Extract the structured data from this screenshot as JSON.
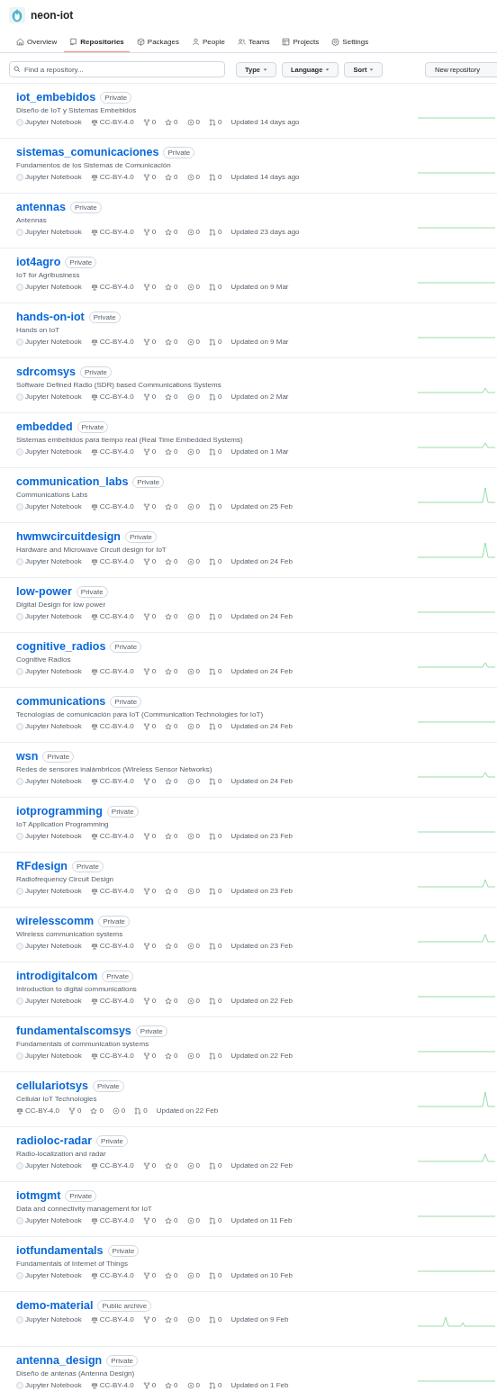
{
  "org": {
    "name": "neon-iot"
  },
  "tabs": [
    {
      "label": "Overview",
      "selected": false
    },
    {
      "label": "Repositories",
      "selected": true
    },
    {
      "label": "Packages",
      "selected": false
    },
    {
      "label": "People",
      "selected": false
    },
    {
      "label": "Teams",
      "selected": false
    },
    {
      "label": "Projects",
      "selected": false
    },
    {
      "label": "Settings",
      "selected": false
    }
  ],
  "search": {
    "placeholder": "Find a repository..."
  },
  "filters": [
    "Type",
    "Language",
    "Sort"
  ],
  "new_button": "New repository",
  "repositories": [
    {
      "name": "iot_embebidos",
      "badge": "Private",
      "description": "Diseño de IoT y Sistemas Embebidos",
      "language": "Jupyter Notebook",
      "license": "CC-BY-4.0",
      "forks": "0",
      "stars": "0",
      "issues": "0",
      "pulls": "0",
      "updated": "Updated 14 days ago"
    },
    {
      "name": "sistemas_comunicaciones",
      "badge": "Private",
      "description": "Fundamentos de los Sistemas de Comunicación",
      "language": "Jupyter Notebook",
      "license": "CC-BY-4.0",
      "forks": "0",
      "stars": "0",
      "issues": "0",
      "pulls": "0",
      "updated": "Updated 14 days ago"
    },
    {
      "name": "antennas",
      "badge": "Private",
      "description": "Antennas",
      "language": "Jupyter Notebook",
      "license": "CC-BY-4.0",
      "forks": "0",
      "stars": "0",
      "issues": "0",
      "pulls": "0",
      "updated": "Updated 23 days ago"
    },
    {
      "name": "iot4agro",
      "badge": "Private",
      "description": "IoT for Agribusiness",
      "language": "Jupyter Notebook",
      "license": "CC-BY-4.0",
      "forks": "0",
      "stars": "0",
      "issues": "0",
      "pulls": "0",
      "updated": "Updated on 9 Mar"
    },
    {
      "name": "hands-on-iot",
      "badge": "Private",
      "description": "Hands on IoT",
      "language": "Jupyter Notebook",
      "license": "CC-BY-4.0",
      "forks": "0",
      "stars": "0",
      "issues": "0",
      "pulls": "0",
      "updated": "Updated on 9 Mar"
    },
    {
      "name": "sdrcomsys",
      "badge": "Private",
      "description": "Software Defined Radio (SDR) based Communications Systems",
      "language": "Jupyter Notebook",
      "license": "CC-BY-4.0",
      "forks": "0",
      "stars": "0",
      "issues": "0",
      "pulls": "0",
      "updated": "Updated on 2 Mar"
    },
    {
      "name": "embedded",
      "badge": "Private",
      "description": "Sistemas embebidos para tiempo real (Real Time Embedded Systems)",
      "language": "Jupyter Notebook",
      "license": "CC-BY-4.0",
      "forks": "0",
      "stars": "0",
      "issues": "0",
      "pulls": "0",
      "updated": "Updated on 1 Mar"
    },
    {
      "name": "communication_labs",
      "badge": "Private",
      "description": "Communications Labs",
      "language": "Jupyter Notebook",
      "license": "CC-BY-4.0",
      "forks": "0",
      "stars": "0",
      "issues": "0",
      "pulls": "0",
      "updated": "Updated on 25 Feb"
    },
    {
      "name": "hwmwcircuitdesign",
      "badge": "Private",
      "description": "Hardware and Microwave Circuit design for IoT",
      "language": "Jupyter Notebook",
      "license": "CC-BY-4.0",
      "forks": "0",
      "stars": "0",
      "issues": "0",
      "pulls": "0",
      "updated": "Updated on 24 Feb"
    },
    {
      "name": "low-power",
      "badge": "Private",
      "description": "Digital Design for low power",
      "language": "Jupyter Notebook",
      "license": "CC-BY-4.0",
      "forks": "0",
      "stars": "0",
      "issues": "0",
      "pulls": "0",
      "updated": "Updated on 24 Feb"
    },
    {
      "name": "cognitive_radios",
      "badge": "Private",
      "description": "Cognitive Radios",
      "language": "Jupyter Notebook",
      "license": "CC-BY-4.0",
      "forks": "0",
      "stars": "0",
      "issues": "0",
      "pulls": "0",
      "updated": "Updated on 24 Feb"
    },
    {
      "name": "communications",
      "badge": "Private",
      "description": "Tecnologías de comunicación para IoT (Communication Technologies for IoT)",
      "language": "Jupyter Notebook",
      "license": "CC-BY-4.0",
      "forks": "0",
      "stars": "0",
      "issues": "0",
      "pulls": "0",
      "updated": "Updated on 24 Feb"
    },
    {
      "name": "wsn",
      "badge": "Private",
      "description": "Redes de sensores inalámbricos (Wireless Sensor Networks)",
      "language": "Jupyter Notebook",
      "license": "CC-BY-4.0",
      "forks": "0",
      "stars": "0",
      "issues": "0",
      "pulls": "0",
      "updated": "Updated on 24 Feb"
    },
    {
      "name": "iotprogramming",
      "badge": "Private",
      "description": "IoT Application Programming",
      "language": "Jupyter Notebook",
      "license": "CC-BY-4.0",
      "forks": "0",
      "stars": "0",
      "issues": "0",
      "pulls": "0",
      "updated": "Updated on 23 Feb"
    },
    {
      "name": "RFdesign",
      "badge": "Private",
      "description": "Radiofrequency Circuit Design",
      "language": "Jupyter Notebook",
      "license": "CC-BY-4.0",
      "forks": "0",
      "stars": "0",
      "issues": "0",
      "pulls": "0",
      "updated": "Updated on 23 Feb"
    },
    {
      "name": "wirelesscomm",
      "badge": "Private",
      "description": "Wireless communication systems",
      "language": "Jupyter Notebook",
      "license": "CC-BY-4.0",
      "forks": "0",
      "stars": "0",
      "issues": "0",
      "pulls": "0",
      "updated": "Updated on 23 Feb"
    },
    {
      "name": "introdigitalcom",
      "badge": "Private",
      "description": "Introduction to digital communications",
      "language": "Jupyter Notebook",
      "license": "CC-BY-4.0",
      "forks": "0",
      "stars": "0",
      "issues": "0",
      "pulls": "0",
      "updated": "Updated on 22 Feb"
    },
    {
      "name": "fundamentalscomsys",
      "badge": "Private",
      "description": "Fundamentals of communication systems",
      "language": "Jupyter Notebook",
      "license": "CC-BY-4.0",
      "forks": "0",
      "stars": "0",
      "issues": "0",
      "pulls": "0",
      "updated": "Updated on 22 Feb"
    },
    {
      "name": "cellulariotsys",
      "badge": "Private",
      "description": "Cellular IoT Technologies",
      "license": "CC-BY-4.0",
      "forks": "0",
      "stars": "0",
      "issues": "0",
      "pulls": "0",
      "updated": "Updated on 22 Feb"
    },
    {
      "name": "radioloc-radar",
      "badge": "Private",
      "description": "Radio-localization and radar",
      "language": "Jupyter Notebook",
      "license": "CC-BY-4.0",
      "forks": "0",
      "stars": "0",
      "issues": "0",
      "pulls": "0",
      "updated": "Updated on 22 Feb"
    },
    {
      "name": "iotmgmt",
      "badge": "Private",
      "description": "Data and connectivity management for IoT",
      "language": "Jupyter Notebook",
      "license": "CC-BY-4.0",
      "forks": "0",
      "stars": "0",
      "issues": "0",
      "pulls": "0",
      "updated": "Updated on 11 Feb"
    },
    {
      "name": "iotfundamentals",
      "badge": "Private",
      "description": "Fundamentals of Internet of Things",
      "language": "Jupyter Notebook",
      "license": "CC-BY-4.0",
      "forks": "0",
      "stars": "0",
      "issues": "0",
      "pulls": "0",
      "updated": "Updated on 10 Feb"
    },
    {
      "name": "demo-material",
      "badge": "Public archive",
      "language": "Jupyter Notebook",
      "license": "CC-BY-4.0",
      "forks": "0",
      "stars": "0",
      "issues": "0",
      "pulls": "0",
      "updated": "Updated on 9 Feb"
    },
    {
      "name": "antenna_design",
      "badge": "Private",
      "description": "Diseño de antenas (Antenna Design)",
      "language": "Jupyter Notebook",
      "license": "CC-BY-4.0",
      "forks": "0",
      "stars": "0",
      "issues": "0",
      "pulls": "0",
      "updated": "Updated on 1 Feb"
    }
  ]
}
